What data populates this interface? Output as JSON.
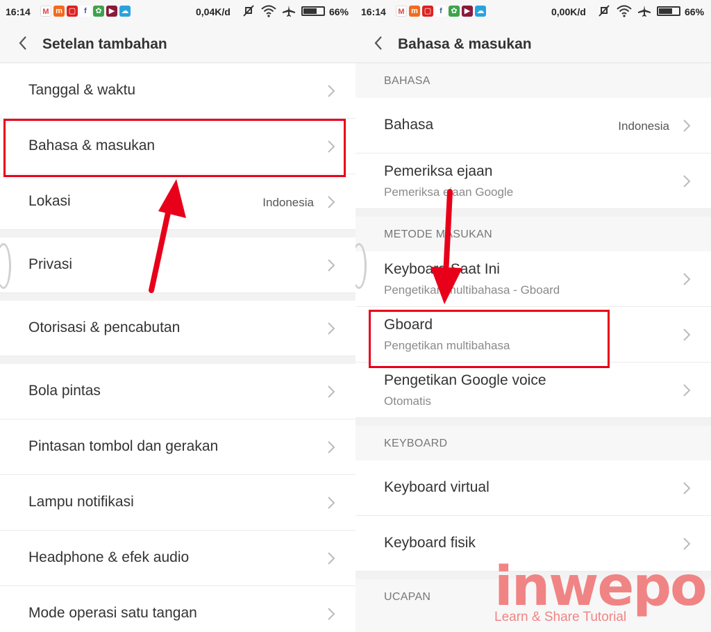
{
  "left": {
    "status": {
      "time": "16:14",
      "speed": "0,04K/d",
      "battery": "66%"
    },
    "header": {
      "title": "Setelan tambahan"
    },
    "items": {
      "tanggal": "Tanggal & waktu",
      "bahasa": "Bahasa & masukan",
      "lokasi": "Lokasi",
      "lokasi_value": "Indonesia",
      "privasi": "Privasi",
      "otorisasi": "Otorisasi & pencabutan",
      "bola": "Bola pintas",
      "pintasan": "Pintasan tombol dan gerakan",
      "lampu": "Lampu notifikasi",
      "headphone": "Headphone & efek audio",
      "mode": "Mode operasi satu tangan"
    }
  },
  "right": {
    "status": {
      "time": "16:14",
      "speed": "0,00K/d",
      "battery": "66%"
    },
    "header": {
      "title": "Bahasa & masukan"
    },
    "sections": {
      "bahasa": "BAHASA",
      "metode": "METODE MASUKAN",
      "keyboard": "KEYBOARD",
      "ucapan": "UCAPAN"
    },
    "items": {
      "bahasa": "Bahasa",
      "bahasa_value": "Indonesia",
      "pemeriksa": "Pemeriksa ejaan",
      "pemeriksa_sub": "Pemeriksa ejaan Google",
      "keyboard_saat_ini": "Keyboard Saat Ini",
      "keyboard_saat_ini_sub": "Pengetikan multibahasa - Gboard",
      "gboard": "Gboard",
      "gboard_sub": "Pengetikan multibahasa",
      "voice": "Pengetikan Google voice",
      "voice_sub": "Otomatis",
      "virtual": "Keyboard virtual",
      "fisik": "Keyboard fisik"
    }
  },
  "watermark": {
    "brand": "inwepo",
    "tagline": "Learn & Share Tutorial"
  },
  "colors": {
    "highlight": "#e8001a",
    "watermark": "#f07b7b"
  },
  "icons": [
    "gmail-icon",
    "mi-icon",
    "app-icon",
    "facebook-icon",
    "photos-icon",
    "youtube-icon",
    "cloud-icon",
    "wifi-icon",
    "mute-icon",
    "airplane-icon",
    "battery-icon",
    "back-arrow-icon",
    "chevron-right-icon"
  ]
}
